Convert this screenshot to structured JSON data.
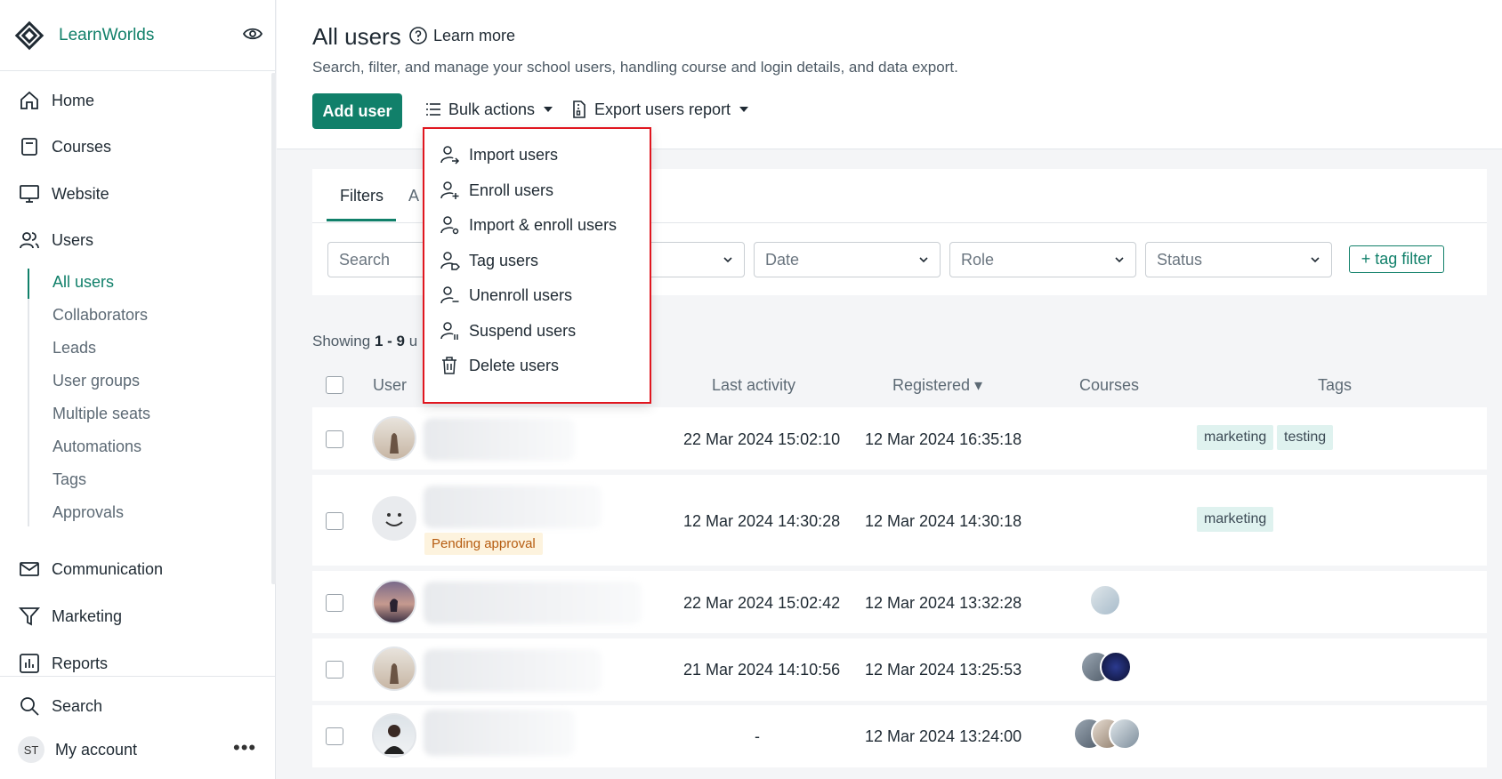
{
  "brand": {
    "name": "LearnWorlds"
  },
  "nav": {
    "home": "Home",
    "courses": "Courses",
    "website": "Website",
    "users": "Users",
    "communication": "Communication",
    "marketing": "Marketing",
    "reports": "Reports",
    "search": "Search",
    "my_account": "My account",
    "account_initials": "ST",
    "more": "•••"
  },
  "users_sub": [
    "All users",
    "Collaborators",
    "Leads",
    "User groups",
    "Multiple seats",
    "Automations",
    "Tags",
    "Approvals"
  ],
  "header": {
    "title": "All users",
    "learn_more": "Learn more",
    "subtitle": "Search, filter, and manage your school users, handling course and login details, and data export."
  },
  "toolbar": {
    "add_user": "Add user",
    "bulk_actions": "Bulk actions",
    "export_report": "Export users report"
  },
  "bulk_menu": [
    "Import users",
    "Enroll users",
    "Import & enroll users",
    "Tag users",
    "Unenroll users",
    "Suspend users",
    "Delete users"
  ],
  "filters": {
    "tab_filters": "Filters",
    "tab_other_partial": "A",
    "search_placeholder": "Search",
    "date": "Date",
    "role": "Role",
    "status": "Status",
    "tag_filter": "+ tag filter"
  },
  "showing": {
    "prefix": "Showing",
    "range": "1 - 9",
    "suffix": "u"
  },
  "table": {
    "headers": {
      "user": "User",
      "last_activity": "Last activity",
      "registered": "Registered ▾",
      "courses": "Courses",
      "tags": "Tags"
    },
    "rows": [
      {
        "last_activity": "22 Mar 2024 15:02:10",
        "registered": "12 Mar 2024 16:35:18",
        "tags": [
          "marketing",
          "testing"
        ]
      },
      {
        "last_activity": "12 Mar 2024 14:30:28",
        "registered": "12 Mar 2024 14:30:18",
        "tags": [
          "marketing"
        ],
        "badge": "Pending approval"
      },
      {
        "last_activity": "22 Mar 2024 15:02:42",
        "registered": "12 Mar 2024 13:32:28",
        "tags": []
      },
      {
        "last_activity": "21 Mar 2024 14:10:56",
        "registered": "12 Mar 2024 13:25:53",
        "tags": []
      },
      {
        "last_activity": "-",
        "registered": "12 Mar 2024 13:24:00",
        "tags": []
      }
    ]
  },
  "colors": {
    "accent": "#11806a",
    "highlight": "#e0161f",
    "tag_bg": "#dff2ef",
    "pending_bg": "#fdf3de"
  }
}
